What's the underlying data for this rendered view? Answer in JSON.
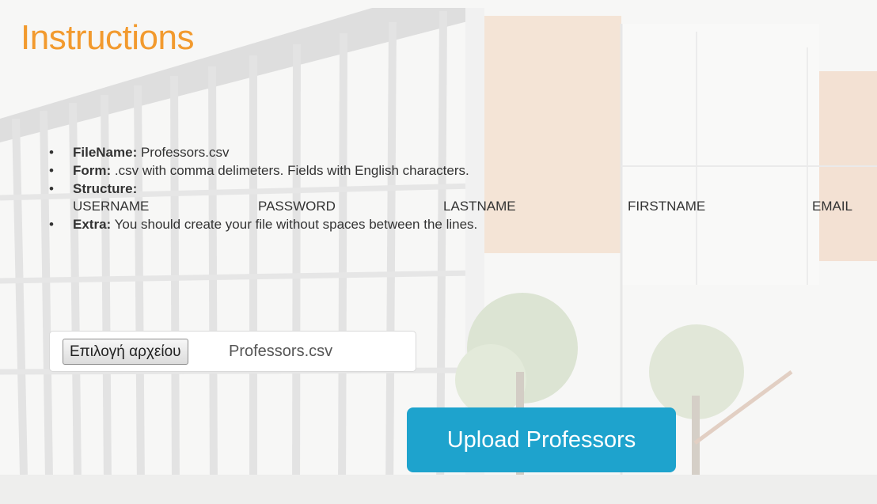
{
  "page": {
    "title": "Instructions"
  },
  "instructions": [
    {
      "label": "FileName:",
      "text": " Professors.csv"
    },
    {
      "label": "Form:",
      "text": " .csv with comma delimeters. Fields with English characters."
    },
    {
      "label": "Structure:",
      "text": ""
    },
    {
      "label": "Extra:",
      "text": " You should create your file without spaces between the lines."
    }
  ],
  "structure_columns": [
    "USERNAME",
    "PASSWORD",
    "LASTNAME",
    "FIRSTNAME",
    "EMAIL"
  ],
  "file_input": {
    "button_label": "Επιλογή αρχείου",
    "selected_file": "Professors.csv"
  },
  "upload": {
    "button_label": "Upload Professors"
  },
  "colors": {
    "title": "#f29a2e",
    "upload_button": "#1ea3cd",
    "text": "#333333"
  },
  "icons": {
    "bullet": "bullet-icon"
  }
}
